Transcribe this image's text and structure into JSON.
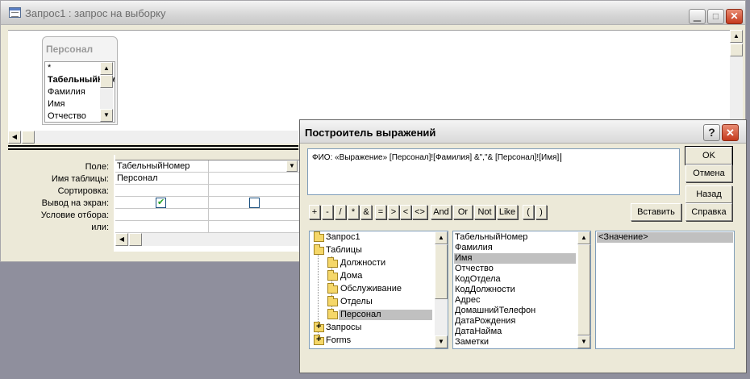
{
  "query_window": {
    "title": "Запрос1 : запрос на выборку",
    "table_box": {
      "title": "Персонал",
      "fields": [
        "*",
        "ТабельныйНомер",
        "Фамилия",
        "Имя",
        "Отчество"
      ]
    },
    "grid": {
      "row_labels": [
        "Поле:",
        "Имя таблицы:",
        "Сортировка:",
        "Вывод на экран:",
        "Условие отбора:",
        "или:"
      ],
      "column1": {
        "field": "ТабельныйНомер",
        "table": "Персонал",
        "show": true
      },
      "column2": {
        "show": false
      }
    }
  },
  "dialog": {
    "title": "Построитель выражений",
    "expression": "ФИО: «Выражение» [Персонал]![Фамилия] &\",\"& [Персонал]![Имя]",
    "operators": [
      "+",
      "-",
      "/",
      "*",
      "&",
      "=",
      ">",
      "<",
      "<>",
      "And",
      "Or",
      "Not",
      "Like",
      "(",
      ")"
    ],
    "insert_button": "Вставить",
    "buttons": {
      "ok": "OK",
      "cancel": "Отмена",
      "back": "Назад",
      "help": "Справка"
    },
    "tree": [
      {
        "label": "Запрос1",
        "kind": "folder"
      },
      {
        "label": "Таблицы",
        "kind": "open-folder"
      },
      {
        "label": "Должности",
        "kind": "folder"
      },
      {
        "label": "Дома",
        "kind": "folder"
      },
      {
        "label": "Обслуживание",
        "kind": "folder"
      },
      {
        "label": "Отделы",
        "kind": "folder"
      },
      {
        "label": "Персонал",
        "kind": "open-folder",
        "selected": true
      },
      {
        "label": "Запросы",
        "kind": "plus-folder"
      },
      {
        "label": "Forms",
        "kind": "plus-folder"
      }
    ],
    "fields_list": [
      "ТабельныйНомер",
      "Фамилия",
      "Имя",
      "Отчество",
      "КодОтдела",
      "КодДолжности",
      "Адрес",
      "ДомашнийТелефон",
      "ДатаРождения",
      "ДатаНайма",
      "Заметки"
    ],
    "fields_selected": "Имя",
    "values_list": [
      "<Значение>"
    ]
  }
}
